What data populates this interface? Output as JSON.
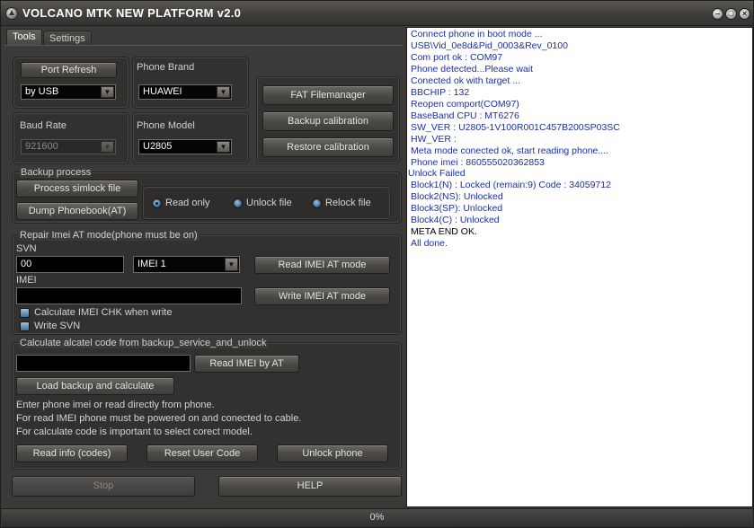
{
  "window": {
    "title": "VOLCANO MTK NEW PLATFORM v2.0"
  },
  "tabs": [
    {
      "label": "Tools",
      "active": true
    },
    {
      "label": "Settings",
      "active": false
    }
  ],
  "connection": {
    "port_refresh_label": "Port Refresh",
    "port_type": "by USB",
    "baud_rate_label": "Baud Rate",
    "baud_rate": "921600",
    "phone_brand_label": "Phone Brand",
    "phone_brand": "HUAWEI",
    "phone_model_label": "Phone Model",
    "phone_model": "U2805"
  },
  "right_actions": {
    "fat_label": "FAT Filemanager",
    "backup_cal_label": "Backup calibration",
    "restore_cal_label": "Restore calibration"
  },
  "backup": {
    "group_label": "Backup process",
    "simlock_label": "Process simlock file",
    "phonebook_label": "Dump Phonebook(AT)",
    "radios": [
      {
        "label": "Read only",
        "checked": true
      },
      {
        "label": "Unlock file",
        "checked": false
      },
      {
        "label": "Relock file",
        "checked": false
      }
    ]
  },
  "repair": {
    "group_label": "Repair Imei AT mode(phone must be on)",
    "svn_label": "SVN",
    "svn_value": "00",
    "imei_slot": "IMEI 1",
    "read_imei_label": "Read IMEI AT mode",
    "imei_label": "IMEI",
    "imei_value": "",
    "write_imei_label": "Write IMEI AT mode",
    "calc_chk_label": "Calculate IMEI CHK when write",
    "write_svn_label": "Write SVN"
  },
  "alcatel": {
    "group_label": "Calculate alcatel code from backup_service_and_unlock",
    "imei_input": "",
    "read_imei_at_label": "Read IMEI by AT",
    "load_backup_label": "Load backup and calculate",
    "info_lines": [
      "Enter phone imei or read directly from phone.",
      "For read IMEI phone must be powered on and conected to cable.",
      "For calculate code is important to select corect model."
    ],
    "read_info_label": "Read info (codes)",
    "reset_user_label": "Reset User Code",
    "unlock_phone_label": "Unlock phone"
  },
  "bottom": {
    "stop_label": "Stop",
    "help_label": "HELP"
  },
  "log": [
    {
      "text": "Connect phone in boot mode ...",
      "color": "blue"
    },
    {
      "text": "USB\\Vid_0e8d&Pid_0003&Rev_0100",
      "color": "blue"
    },
    {
      "text": "Com port ok : COM97",
      "color": "blue"
    },
    {
      "text": "Phone detected...Please wait",
      "color": "blue"
    },
    {
      "text": "Conected ok with target ...",
      "color": "blue"
    },
    {
      "text": "BBCHIP : 132",
      "color": "blue"
    },
    {
      "text": "Reopen comport(COM97)",
      "color": "blue"
    },
    {
      "text": "BaseBand CPU : MT6276",
      "color": "blue"
    },
    {
      "text": "SW_VER : U2805-1V100R001C457B200SP03SC",
      "color": "blue"
    },
    {
      "text": "HW_VER :",
      "color": "blue"
    },
    {
      "text": "Meta mode conected ok, start reading phone....",
      "color": "blue"
    },
    {
      "text": "Phone imei : 860555020362853",
      "color": "blue"
    },
    {
      "text": "Unlock Failed",
      "color": "blue"
    },
    {
      "text": "Block1(N)  : Locked (remain:9) Code : 34059712",
      "color": "blue"
    },
    {
      "text": "Block2(NS): Unlocked",
      "color": "blue"
    },
    {
      "text": "Block3(SP): Unlocked",
      "color": "blue"
    },
    {
      "text": "Block4(C)  : Unlocked",
      "color": "blue"
    },
    {
      "text": "META END OK.",
      "color": "black"
    },
    {
      "text": "All done.",
      "color": "blue"
    }
  ],
  "status": {
    "progress_text": "0%"
  }
}
